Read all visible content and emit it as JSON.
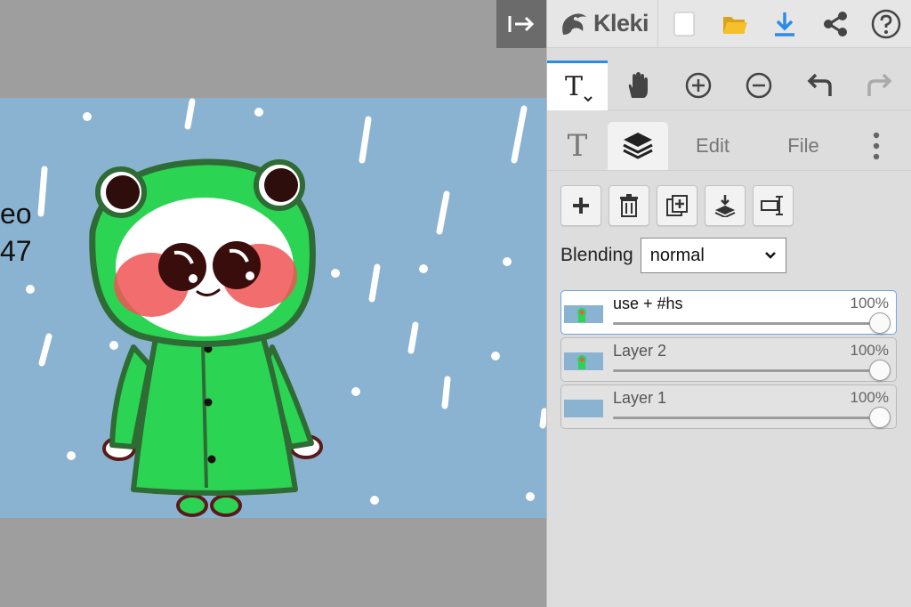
{
  "canvas": {
    "text_line_1": "eo",
    "text_line_2": "47",
    "colors": {
      "background": "#8ab3d1",
      "raincoat": "#2bd452",
      "outline": "#2f6b34",
      "blush": "#f05454"
    }
  },
  "app": {
    "logo": "Kleki"
  },
  "topbar": {
    "icons": [
      "new-document-icon",
      "open-folder-icon",
      "download-icon",
      "share-icon",
      "help-icon"
    ]
  },
  "tools": {
    "icons": [
      "text-tool-icon",
      "hand-icon",
      "zoom-in-icon",
      "zoom-out-icon",
      "undo-icon",
      "redo-icon"
    ]
  },
  "tabs": {
    "brush": "T",
    "edit": "Edit",
    "file": "File"
  },
  "layer_buttons": [
    "add-layer-icon",
    "delete-layer-icon",
    "duplicate-layer-icon",
    "merge-down-icon",
    "rename-layer-icon"
  ],
  "blending": {
    "label": "Blending",
    "value": "normal"
  },
  "layers": [
    {
      "name": "use + #hs",
      "opacity": "100%",
      "selected": true
    },
    {
      "name": "Layer 2",
      "opacity": "100%",
      "selected": false
    },
    {
      "name": "Layer 1",
      "opacity": "100%",
      "selected": false
    }
  ],
  "accent_color": "#2b8be8"
}
